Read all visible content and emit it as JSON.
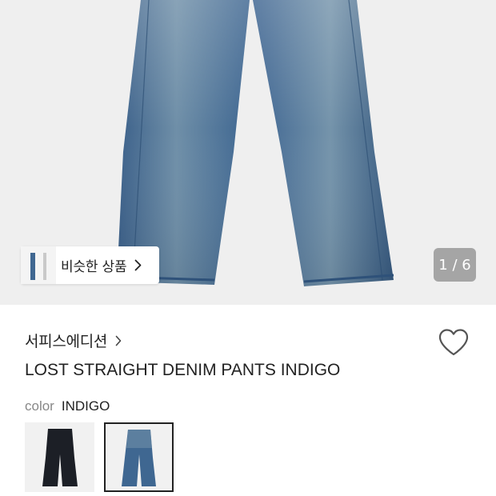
{
  "gallery": {
    "similar_button_label": "비슷한 상품",
    "counter": "1 / 6",
    "current_index": 1,
    "total": 6
  },
  "product": {
    "brand": "서피스에디션",
    "title": "LOST STRAIGHT DENIM PANTS INDIGO",
    "color_label": "color",
    "color_value": "INDIGO",
    "swatches": [
      "black",
      "indigo"
    ],
    "selected_swatch": "indigo"
  },
  "colors": {
    "background": "#efefef",
    "denim": "#3f6791",
    "black_denim": "#1c1f26",
    "text": "#222222",
    "muted": "#888888"
  },
  "icons": [
    "chevron-right-icon",
    "heart-icon"
  ]
}
